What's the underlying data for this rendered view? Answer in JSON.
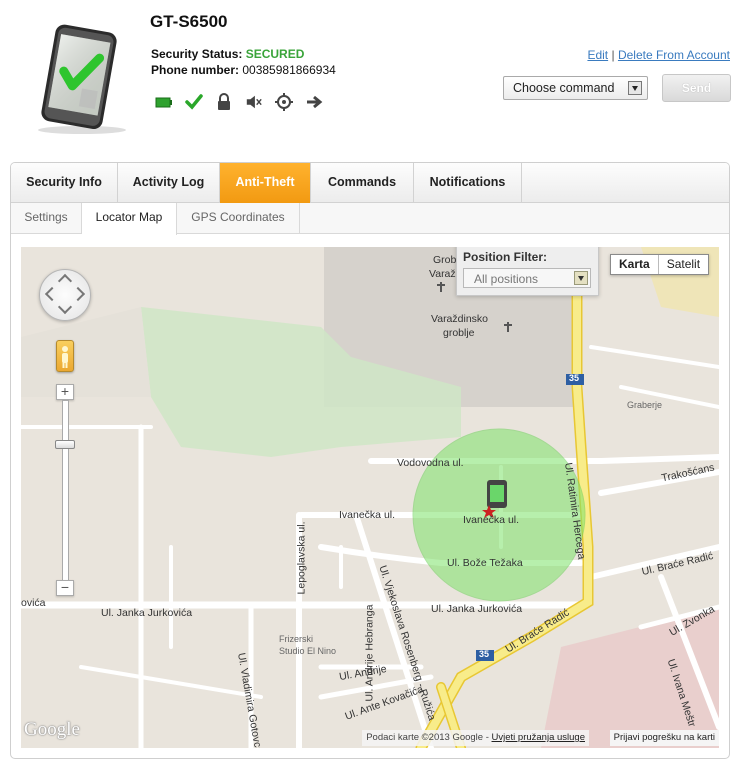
{
  "colors": {
    "accent_orange": "#f5a01a",
    "secured_green": "#3aa43a",
    "link_blue": "#3a7bbf",
    "map_circle": "#7ee36a"
  },
  "device": {
    "name": "GT-S6500",
    "security_status_label": "Security Status:",
    "security_status_value": "SECURED",
    "phone_label": "Phone number:",
    "phone_value": "00385981866934",
    "status_icons": [
      "battery-icon",
      "check-icon",
      "lock-icon",
      "mute-icon",
      "locate-icon",
      "arrow-right-icon"
    ]
  },
  "account_links": {
    "edit": "Edit",
    "separator": "|",
    "delete": "Delete From Account"
  },
  "command": {
    "selected": "Choose command",
    "send_label": "Send"
  },
  "tabs": [
    {
      "label": "Security Info"
    },
    {
      "label": "Activity Log"
    },
    {
      "label": "Anti-Theft"
    },
    {
      "label": "Commands"
    },
    {
      "label": "Notifications"
    }
  ],
  "active_tab": "Anti-Theft",
  "subtabs": [
    {
      "label": "Settings"
    },
    {
      "label": "Locator Map"
    },
    {
      "label": "GPS Coordinates"
    }
  ],
  "active_subtab": "Locator Map",
  "map": {
    "position_filter_label": "Position Filter:",
    "position_filter_value": "All positions",
    "map_type_karta": "Karta",
    "map_type_satelit": "Satelit",
    "logo": "Google",
    "attribution": "Podaci karte ©2013 Google -",
    "terms_link": "Uvjeti pružanja usluge",
    "report_link": "Prijavi pogrešku na karti",
    "labels": {
      "groblje1": "Grob",
      "groblje2": "Varaž",
      "varazdinsko": "Varaždinsko",
      "groblje": "groblje",
      "graberje": "Graberje",
      "vodovodna": "Vodovodna ul.",
      "ivanecka_left": "Ivanečka ul.",
      "ivanecka_right": "Ivanečka ul.",
      "boze_tezaka": "Ul. Bože Težaka",
      "trakoscans": "Trakošćans",
      "ratimira": "Ul. Ratimira Hercega",
      "brace_radic_right": "Ul. Braće Radić",
      "brace_radic_diag": "Ul. Braće Radić",
      "janka": "Ul. Janka Jurkovića",
      "janka_right": "Ul. Janka Jurkovića",
      "ovica": "ovića",
      "lepoglavska": "Lepoglavska ul.",
      "vjekoslava": "Ul. Vjekoslava Rosenberg - Ružića",
      "andrije_hebranga": "Ul. Andrije Hebranga",
      "frizerski1": "Frizerski",
      "frizerski2": "Studio El Nino",
      "vladimira": "Ul. Vladimira Gotovca",
      "andrije": "Ul. Andrije",
      "ante": "Ul. Ante Kovačića",
      "zvonka": "Ul. Zvonka",
      "ivana": "Ul. Ivana Meštr",
      "route35a": "35",
      "route35b": "35",
      "route35c": "35"
    }
  }
}
